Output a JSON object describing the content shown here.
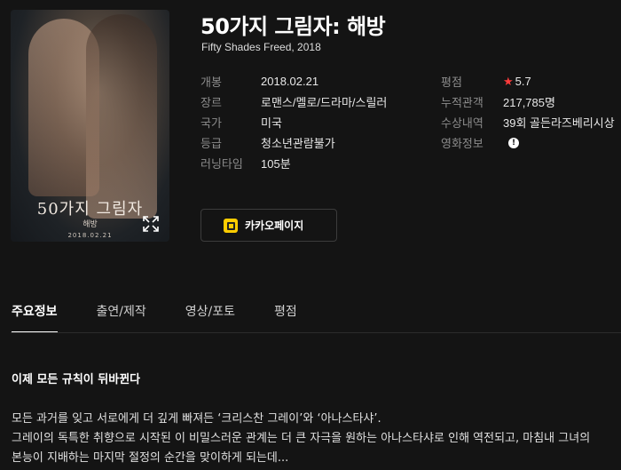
{
  "movie": {
    "title": "50가지 그림자: 해방",
    "subtitle": "Fifty Shades Freed, 2018"
  },
  "poster": {
    "title": "50가지 그림자",
    "sub": "해방",
    "date": "2018.02.21"
  },
  "info_left": [
    {
      "label": "개봉",
      "value": "2018.02.21"
    },
    {
      "label": "장르",
      "value": "로맨스/멜로/드라마/스릴러"
    },
    {
      "label": "국가",
      "value": "미국"
    },
    {
      "label": "등급",
      "value": "청소년관람불가"
    },
    {
      "label": "러닝타임",
      "value": "105분"
    }
  ],
  "info_right": [
    {
      "label": "평점",
      "value": "5.7"
    },
    {
      "label": "누적관객",
      "value": "217,785명"
    },
    {
      "label": "수상내역",
      "value": "39회 골든라즈베리시상"
    },
    {
      "label": "영화정보",
      "value": "!"
    }
  ],
  "kakao_button": {
    "label": "카카오페이지"
  },
  "tabs": [
    {
      "label": "주요정보"
    },
    {
      "label": "출연/제작"
    },
    {
      "label": "영상/포토"
    },
    {
      "label": "평점"
    }
  ],
  "tagline": "이제 모든 규칙이 뒤바뀐다",
  "synopsis": [
    "모든 과거를 잊고 서로에게 더 깊게 빠져든 ‘크리스찬 그레이’와 ‘아나스타샤’.",
    "그레이의 독특한 취향으로 시작된 이 비밀스러운 관계는 더 큰 자극을 원하는 아나스타샤로 인해 역전되고, 마침내 그녀의",
    "본능이 지배하는 마지막 절정의 순간을 맞이하게 되는데..."
  ],
  "colors": {
    "background": "#141414",
    "rating_star": "#ff3b3b",
    "link": "#4ea1ff",
    "kakao_icon": "#ffcd00"
  },
  "icons": {
    "expand": "expand-icon",
    "star": "star-icon",
    "info": "info-icon",
    "kakao": "kakaopage-icon"
  }
}
